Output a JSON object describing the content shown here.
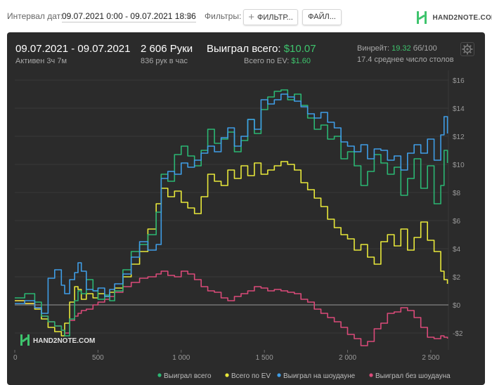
{
  "topbar": {
    "date_label": "Интервал дат:",
    "date_range": "09.07.2021 0:00 - 09.07.2021 18:36",
    "filters_label": "Фильтры:",
    "filter_button": "ФИЛЬТР...",
    "file_button": "ФАЙЛ...",
    "logo_text": "HAND2NOTE.COM"
  },
  "summary": {
    "period": "09.07.2021 - 09.07.2021",
    "active": "Активен 3ч 7м",
    "hands": "2 606 Руки",
    "hands_per_hour": "836 рук в час",
    "won_label": "Выиграл всего:",
    "won_value": "$10.07",
    "ev_label": "Всего по EV:",
    "ev_value": "$1.60",
    "winrate_label": "Винрейт:",
    "winrate_value": "19.32",
    "winrate_unit": "бб/100",
    "avg_tables": "17.4 среднее число столов"
  },
  "chart_data": {
    "type": "line",
    "watermark": "HAND2NOTE.COM",
    "xlim": [
      0,
      2606
    ],
    "ylim": [
      -3.2,
      16.5
    ],
    "x_ticks": [
      0,
      500,
      1000,
      1500,
      2000,
      2500
    ],
    "x_tick_labels": [
      "0",
      "500",
      "1 000",
      "1 500",
      "2 000",
      "2 500"
    ],
    "y_ticks": [
      -2,
      0,
      2,
      4,
      6,
      8,
      10,
      12,
      14,
      16
    ],
    "y_tick_labels": [
      "-$2",
      "$0",
      "$2",
      "$4",
      "$6",
      "$8",
      "$10",
      "$12",
      "$14",
      "$16"
    ],
    "grid": true,
    "legend_position": "bottom-right",
    "series": [
      {
        "name": "Выиграл всего",
        "color": "#2bb673",
        "x": [
          0,
          60,
          120,
          160,
          200,
          240,
          280,
          300,
          330,
          360,
          380,
          400,
          430,
          470,
          500,
          540,
          570,
          600,
          650,
          700,
          750,
          800,
          850,
          880,
          920,
          960,
          1000,
          1040,
          1080,
          1120,
          1160,
          1200,
          1240,
          1280,
          1320,
          1360,
          1400,
          1440,
          1480,
          1520,
          1560,
          1600,
          1640,
          1680,
          1720,
          1760,
          1800,
          1840,
          1880,
          1920,
          1960,
          2000,
          2040,
          2080,
          2120,
          2160,
          2200,
          2240,
          2280,
          2320,
          2360,
          2400,
          2440,
          2480,
          2520,
          2560,
          2580,
          2600
        ],
        "y": [
          0.5,
          0.8,
          0.2,
          -0.8,
          -1.2,
          -1.5,
          -1.8,
          -2.2,
          -1.0,
          0.3,
          1.0,
          0.8,
          1.8,
          1.0,
          0.4,
          0.7,
          0.3,
          1.0,
          2.5,
          3.8,
          4.3,
          5.0,
          6.6,
          9.3,
          8.8,
          10.7,
          11.3,
          10.6,
          9.9,
          11.0,
          12.5,
          11.5,
          11.8,
          12.3,
          10.9,
          11.7,
          13.2,
          12.2,
          13.9,
          14.8,
          15.2,
          15.3,
          14.6,
          15.0,
          14.2,
          13.3,
          12.5,
          12.8,
          11.8,
          12.0,
          10.4,
          10.9,
          9.9,
          8.5,
          9.5,
          10.7,
          10.1,
          9.3,
          9.8,
          7.8,
          9.0,
          10.4,
          8.3,
          9.9,
          7.2,
          8.5,
          11.0,
          10.1
        ]
      },
      {
        "name": "Всего по EV",
        "color": "#e8e83a",
        "x": [
          0,
          60,
          120,
          160,
          200,
          240,
          280,
          300,
          330,
          360,
          380,
          400,
          430,
          470,
          500,
          540,
          570,
          600,
          650,
          700,
          750,
          800,
          850,
          880,
          920,
          960,
          1000,
          1040,
          1080,
          1120,
          1160,
          1200,
          1240,
          1280,
          1320,
          1360,
          1400,
          1440,
          1480,
          1520,
          1560,
          1600,
          1640,
          1680,
          1720,
          1760,
          1800,
          1840,
          1880,
          1920,
          1960,
          2000,
          2040,
          2080,
          2120,
          2160,
          2200,
          2240,
          2280,
          2320,
          2360,
          2400,
          2440,
          2480,
          2520,
          2560,
          2580,
          2600
        ],
        "y": [
          0.3,
          0.1,
          -0.3,
          -1.0,
          -1.6,
          -1.9,
          -2.2,
          -1.3,
          0.2,
          1.3,
          1.1,
          0.4,
          0.8,
          0.5,
          0.8,
          0.6,
          0.9,
          1.2,
          2.0,
          2.9,
          3.8,
          5.4,
          7.2,
          8.3,
          7.7,
          8.1,
          7.3,
          6.9,
          6.5,
          7.7,
          9.3,
          8.8,
          8.5,
          9.6,
          9.0,
          9.9,
          9.2,
          10.1,
          9.3,
          9.6,
          9.9,
          10.2,
          10.0,
          9.6,
          8.7,
          8.2,
          7.6,
          7.0,
          6.1,
          5.5,
          5.0,
          4.7,
          3.9,
          4.3,
          3.4,
          2.9,
          4.5,
          5.0,
          4.2,
          5.4,
          3.9,
          4.8,
          5.9,
          4.6,
          3.8,
          2.4,
          1.8,
          1.5
        ]
      },
      {
        "name": "Выиграл на шоудауне",
        "color": "#3f9de6",
        "x": [
          0,
          60,
          120,
          160,
          200,
          240,
          280,
          300,
          330,
          360,
          380,
          400,
          430,
          470,
          500,
          540,
          570,
          600,
          650,
          700,
          750,
          800,
          850,
          880,
          920,
          960,
          1000,
          1040,
          1080,
          1120,
          1160,
          1200,
          1240,
          1280,
          1320,
          1360,
          1400,
          1440,
          1480,
          1520,
          1560,
          1600,
          1640,
          1680,
          1720,
          1760,
          1800,
          1840,
          1880,
          1920,
          1960,
          2000,
          2040,
          2080,
          2120,
          2160,
          2200,
          2240,
          2280,
          2320,
          2360,
          2400,
          2440,
          2480,
          2520,
          2560,
          2580,
          2600
        ],
        "y": [
          0.1,
          0.3,
          -0.2,
          -0.6,
          1.9,
          2.5,
          1.4,
          0.8,
          1.8,
          2.3,
          3.0,
          2.4,
          1.1,
          1.0,
          1.2,
          0.6,
          1.1,
          1.5,
          2.2,
          3.4,
          4.5,
          3.9,
          4.3,
          9.0,
          9.5,
          9.3,
          10.1,
          9.8,
          10.3,
          10.8,
          11.3,
          10.9,
          11.9,
          12.6,
          11.3,
          12.0,
          13.2,
          12.5,
          14.6,
          14.3,
          14.6,
          15.0,
          14.8,
          14.5,
          14.1,
          13.6,
          13.3,
          13.7,
          13.0,
          12.6,
          11.6,
          11.3,
          10.9,
          11.4,
          10.4,
          11.1,
          11.0,
          10.3,
          10.6,
          9.6,
          10.8,
          11.4,
          10.8,
          11.8,
          10.3,
          12.1,
          13.4,
          12.2
        ]
      },
      {
        "name": "Выиграл без шоудауна",
        "color": "#d94a79",
        "x": [
          0,
          60,
          120,
          160,
          200,
          240,
          280,
          300,
          330,
          360,
          380,
          400,
          430,
          470,
          500,
          540,
          570,
          600,
          650,
          700,
          750,
          800,
          850,
          880,
          920,
          960,
          1000,
          1040,
          1080,
          1120,
          1160,
          1200,
          1240,
          1280,
          1320,
          1360,
          1400,
          1440,
          1480,
          1520,
          1560,
          1600,
          1640,
          1680,
          1720,
          1760,
          1800,
          1840,
          1880,
          1920,
          1960,
          2000,
          2040,
          2080,
          2120,
          2160,
          2200,
          2240,
          2280,
          2320,
          2360,
          2400,
          2440,
          2480,
          2520,
          2560,
          2580,
          2600
        ],
        "y": [
          0.3,
          0.1,
          -0.2,
          -0.8,
          -1.2,
          -1.5,
          -1.8,
          -2.0,
          -1.1,
          -0.8,
          -0.6,
          -0.4,
          -0.3,
          0.0,
          0.2,
          0.4,
          0.6,
          0.9,
          1.3,
          1.6,
          1.9,
          2.0,
          2.2,
          2.4,
          2.1,
          2.0,
          2.4,
          2.2,
          1.8,
          1.3,
          1.0,
          0.9,
          0.5,
          0.3,
          0.6,
          0.8,
          1.0,
          1.3,
          1.2,
          1.0,
          1.1,
          1.0,
          0.9,
          0.8,
          0.4,
          0.2,
          -0.3,
          -0.6,
          -0.9,
          -1.2,
          -1.6,
          -2.1,
          -2.4,
          -2.9,
          -2.6,
          -1.7,
          -1.3,
          -0.6,
          -0.5,
          -0.2,
          -0.4,
          -0.9,
          -1.6,
          -2.3,
          -2.4,
          -2.2,
          -2.3,
          -2.4
        ]
      }
    ]
  }
}
